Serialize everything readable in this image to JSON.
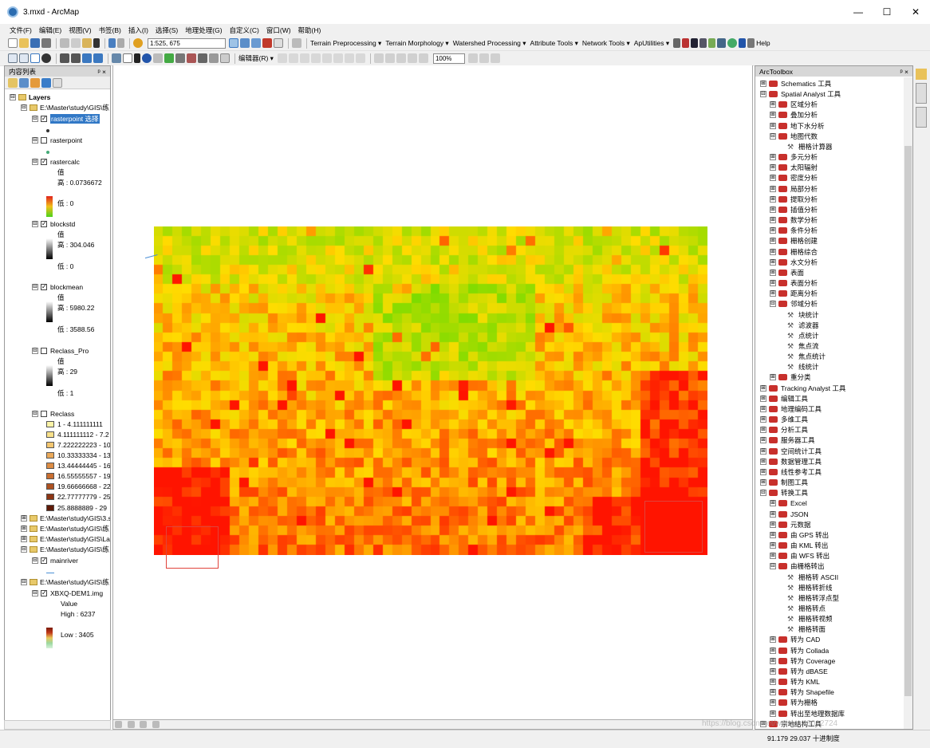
{
  "window": {
    "title": "3.mxd - ArcMap",
    "controls": [
      "—",
      "☐",
      "✕"
    ]
  },
  "menu": [
    "文件(F)",
    "编辑(E)",
    "视图(V)",
    "书签(B)",
    "插入(I)",
    "选择(S)",
    "地理处理(G)",
    "自定义(C)",
    "窗口(W)",
    "帮助(H)"
  ],
  "toolbar1": {
    "scale": "1:525, 675",
    "items": [
      "Terrain Preprocessing ▾",
      "Terrain Morphology ▾",
      "Watershed Processing ▾",
      "Attribute Tools ▾",
      "Network Tools ▾",
      "ApUtilities ▾"
    ],
    "help": "Help"
  },
  "toolbar2": {
    "editor": "编辑器(R) ▾",
    "zoom": "100%"
  },
  "toc": {
    "title": "内容列表",
    "pin": "ᵖ ×",
    "rows": [
      {
        "indent": 6,
        "exp": "⊟",
        "icon": "folder",
        "label": "Layers",
        "bold": true
      },
      {
        "indent": 20,
        "exp": "⊟",
        "icon": "folder",
        "label": "E:\\Master\\study\\GIS\\练"
      },
      {
        "indent": 34,
        "exp": "⊟",
        "chk": "✓",
        "label": "rasterpoint 选择",
        "selected": true
      },
      {
        "indent": 52,
        "dot": true
      },
      {
        "indent": 34,
        "exp": "⊟",
        "chk": "",
        "label": "rasterpoint"
      },
      {
        "indent": 52,
        "dot": true,
        "green": true
      },
      {
        "indent": 34,
        "exp": "⊟",
        "chk": "✓",
        "label": "rastercalc"
      },
      {
        "indent": 66,
        "label": "值"
      },
      {
        "indent": 66,
        "label": "高 : 0.0736672"
      },
      {
        "indent": 66,
        "label": ""
      },
      {
        "indent": 66,
        "label": "低 : 0"
      },
      {
        "indent": 34,
        "exp": "⊟",
        "chk": "✓",
        "label": "blockstd"
      },
      {
        "indent": 66,
        "label": "值"
      },
      {
        "indent": 66,
        "label": "高 : 304.046"
      },
      {
        "indent": 66,
        "label": "低 : 0"
      },
      {
        "indent": 34,
        "exp": "⊟",
        "chk": "✓",
        "label": "blockmean"
      },
      {
        "indent": 66,
        "label": "值"
      },
      {
        "indent": 66,
        "label": "高 : 5980.22"
      },
      {
        "indent": 66,
        "label": "低 : 3588.56"
      },
      {
        "indent": 34,
        "exp": "⊟",
        "chk": "",
        "label": "Reclass_Pro"
      },
      {
        "indent": 66,
        "label": "值"
      },
      {
        "indent": 66,
        "label": "高 : 29"
      },
      {
        "indent": 66,
        "label": "低 : 1"
      },
      {
        "indent": 34,
        "exp": "⊟",
        "chk": "",
        "label": "Reclass"
      },
      {
        "indent": 52,
        "sw": "#fbf3a6",
        "label": "1 - 4.111111111"
      },
      {
        "indent": 52,
        "sw": "#f8e08a",
        "label": "4.111111112 - 7.2"
      },
      {
        "indent": 52,
        "sw": "#f3c670",
        "label": "7.222222223 - 10"
      },
      {
        "indent": 52,
        "sw": "#eaa95a",
        "label": "10.33333334 - 13"
      },
      {
        "indent": 52,
        "sw": "#dc8c44",
        "label": "13.44444445 - 16"
      },
      {
        "indent": 52,
        "sw": "#c86e30",
        "label": "16.55555557 - 19"
      },
      {
        "indent": 52,
        "sw": "#ad5120",
        "label": "19.66666668 - 22"
      },
      {
        "indent": 52,
        "sw": "#8c3514",
        "label": "22.77777779 - 25"
      },
      {
        "indent": 52,
        "sw": "#5e1a08",
        "label": "25.8888889 - 29"
      },
      {
        "indent": 20,
        "exp": "⊞",
        "icon": "folder",
        "label": "E:\\Master\\study\\GIS\\3.s"
      },
      {
        "indent": 20,
        "exp": "⊞",
        "icon": "folder",
        "label": "E:\\Master\\study\\GIS\\练"
      },
      {
        "indent": 20,
        "exp": "⊞",
        "icon": "folder",
        "label": "E:\\Master\\study\\GIS\\La"
      },
      {
        "indent": 20,
        "exp": "⊟",
        "icon": "folder",
        "label": "E:\\Master\\study\\GIS\\练"
      },
      {
        "indent": 34,
        "exp": "⊟",
        "chk": "✓",
        "label": "mainriver"
      },
      {
        "indent": 52,
        "line": true
      },
      {
        "indent": 20,
        "exp": "⊟",
        "icon": "folder",
        "label": "E:\\Master\\study\\GIS\\练"
      },
      {
        "indent": 34,
        "exp": "⊟",
        "chk": "✓",
        "label": "XBXQ-DEM1.img"
      },
      {
        "indent": 70,
        "label": "Value"
      },
      {
        "indent": 70,
        "label": "High : 6237"
      },
      {
        "indent": 70,
        "label": ""
      },
      {
        "indent": 70,
        "label": "Low : 3405"
      }
    ]
  },
  "toolbox": {
    "title": "ArcToolbox",
    "pin": "ᵖ ×",
    "rows": [
      {
        "indent": 6,
        "exp": "⊞",
        "label": "Schematics 工具"
      },
      {
        "indent": 6,
        "exp": "⊟",
        "label": "Spatial Analyst 工具"
      },
      {
        "indent": 18,
        "exp": "⊞",
        "label": "区域分析"
      },
      {
        "indent": 18,
        "exp": "⊞",
        "label": "叠加分析"
      },
      {
        "indent": 18,
        "exp": "⊞",
        "label": "地下水分析"
      },
      {
        "indent": 18,
        "exp": "⊟",
        "label": "地图代数"
      },
      {
        "indent": 40,
        "tool": true,
        "label": "栅格计算器"
      },
      {
        "indent": 18,
        "exp": "⊞",
        "label": "多元分析"
      },
      {
        "indent": 18,
        "exp": "⊞",
        "label": "太阳辐射"
      },
      {
        "indent": 18,
        "exp": "⊞",
        "label": "密度分析"
      },
      {
        "indent": 18,
        "exp": "⊞",
        "label": "局部分析"
      },
      {
        "indent": 18,
        "exp": "⊞",
        "label": "提取分析"
      },
      {
        "indent": 18,
        "exp": "⊞",
        "label": "插值分析"
      },
      {
        "indent": 18,
        "exp": "⊞",
        "label": "数学分析"
      },
      {
        "indent": 18,
        "exp": "⊞",
        "label": "条件分析"
      },
      {
        "indent": 18,
        "exp": "⊞",
        "label": "栅格创建"
      },
      {
        "indent": 18,
        "exp": "⊞",
        "label": "栅格综合"
      },
      {
        "indent": 18,
        "exp": "⊞",
        "label": "水文分析"
      },
      {
        "indent": 18,
        "exp": "⊞",
        "label": "表面"
      },
      {
        "indent": 18,
        "exp": "⊞",
        "label": "表面分析"
      },
      {
        "indent": 18,
        "exp": "⊞",
        "label": "距离分析"
      },
      {
        "indent": 18,
        "exp": "⊟",
        "label": "邻域分析"
      },
      {
        "indent": 40,
        "tool": true,
        "label": "块统计"
      },
      {
        "indent": 40,
        "tool": true,
        "label": "滤波器"
      },
      {
        "indent": 40,
        "tool": true,
        "label": "点统计"
      },
      {
        "indent": 40,
        "tool": true,
        "label": "焦点流"
      },
      {
        "indent": 40,
        "tool": true,
        "label": "焦点统计"
      },
      {
        "indent": 40,
        "tool": true,
        "label": "线统计"
      },
      {
        "indent": 18,
        "exp": "⊞",
        "label": "重分类"
      },
      {
        "indent": 6,
        "exp": "⊞",
        "label": "Tracking Analyst 工具"
      },
      {
        "indent": 6,
        "exp": "⊞",
        "label": "编辑工具"
      },
      {
        "indent": 6,
        "exp": "⊞",
        "label": "地理编码工具"
      },
      {
        "indent": 6,
        "exp": "⊞",
        "label": "多维工具"
      },
      {
        "indent": 6,
        "exp": "⊞",
        "label": "分析工具"
      },
      {
        "indent": 6,
        "exp": "⊞",
        "label": "服务器工具"
      },
      {
        "indent": 6,
        "exp": "⊞",
        "label": "空间统计工具"
      },
      {
        "indent": 6,
        "exp": "⊞",
        "label": "数据管理工具"
      },
      {
        "indent": 6,
        "exp": "⊞",
        "label": "线性参考工具"
      },
      {
        "indent": 6,
        "exp": "⊞",
        "label": "制图工具"
      },
      {
        "indent": 6,
        "exp": "⊟",
        "label": "转换工具"
      },
      {
        "indent": 18,
        "exp": "⊞",
        "label": "Excel"
      },
      {
        "indent": 18,
        "exp": "⊞",
        "label": "JSON"
      },
      {
        "indent": 18,
        "exp": "⊞",
        "label": "元数据"
      },
      {
        "indent": 18,
        "exp": "⊞",
        "label": "由 GPS 转出"
      },
      {
        "indent": 18,
        "exp": "⊞",
        "label": "由 KML 转出"
      },
      {
        "indent": 18,
        "exp": "⊞",
        "label": "由 WFS 转出"
      },
      {
        "indent": 18,
        "exp": "⊟",
        "label": "由栅格转出"
      },
      {
        "indent": 40,
        "tool": true,
        "label": "栅格转 ASCII"
      },
      {
        "indent": 40,
        "tool": true,
        "label": "栅格转折线"
      },
      {
        "indent": 40,
        "tool": true,
        "label": "栅格转浮点型"
      },
      {
        "indent": 40,
        "tool": true,
        "label": "栅格转点"
      },
      {
        "indent": 40,
        "tool": true,
        "label": "栅格转视频"
      },
      {
        "indent": 40,
        "tool": true,
        "label": "栅格转面"
      },
      {
        "indent": 18,
        "exp": "⊞",
        "label": "转为 CAD"
      },
      {
        "indent": 18,
        "exp": "⊞",
        "label": "转为 Collada"
      },
      {
        "indent": 18,
        "exp": "⊞",
        "label": "转为 Coverage"
      },
      {
        "indent": 18,
        "exp": "⊞",
        "label": "转为 dBASE"
      },
      {
        "indent": 18,
        "exp": "⊞",
        "label": "转为 KML"
      },
      {
        "indent": 18,
        "exp": "⊞",
        "label": "转为 Shapefile"
      },
      {
        "indent": 18,
        "exp": "⊞",
        "label": "转为栅格"
      },
      {
        "indent": 18,
        "exp": "⊞",
        "label": "转出至地理数据库"
      },
      {
        "indent": 6,
        "exp": "⊞",
        "label": "宗地结构工具"
      }
    ]
  },
  "status": {
    "coords": "91.179  29.037 十进制度",
    "watermark": "https://blog.csdn.net/weixin_43012724"
  },
  "colors": {
    "panel": "#f0f0f0",
    "selection": "#3178c6",
    "box": "#e0433b"
  }
}
